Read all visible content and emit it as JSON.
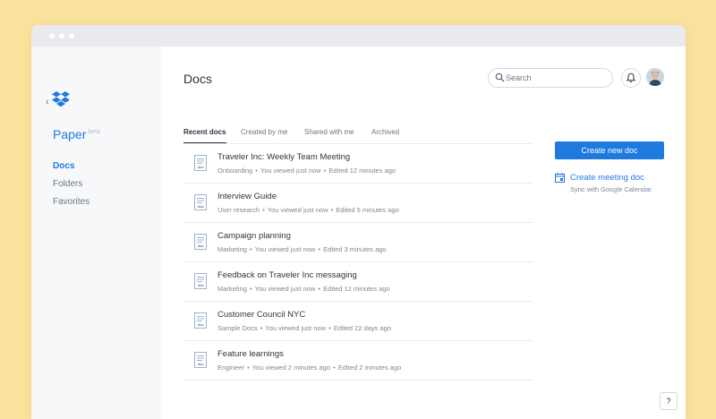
{
  "sidebar": {
    "brand_name": "Paper",
    "brand_sup": "beta",
    "items": [
      {
        "label": "Docs",
        "active": true
      },
      {
        "label": "Folders",
        "active": false
      },
      {
        "label": "Favorites",
        "active": false
      }
    ]
  },
  "header": {
    "title": "Docs",
    "search_placeholder": "Search"
  },
  "tabs": [
    {
      "label": "Recent docs",
      "active": true
    },
    {
      "label": "Created by me",
      "active": false
    },
    {
      "label": "Shared with me",
      "active": false
    },
    {
      "label": "Archived",
      "active": false
    }
  ],
  "docs": [
    {
      "title": "Traveler Inc: Weekly Team Meeting",
      "folder": "Onboarding",
      "viewed": "You viewed just now",
      "edited": "Edited 12 minutes ago"
    },
    {
      "title": "Interview Guide",
      "folder": "User research",
      "viewed": "You viewed just now",
      "edited": "Edited 5 minutes ago"
    },
    {
      "title": "Campaign planning",
      "folder": "Marketing",
      "viewed": "You viewed just now",
      "edited": "Edited 3 minutes ago"
    },
    {
      "title": "Feedback on Traveler Inc messaging",
      "folder": "Marketing",
      "viewed": "You viewed just now",
      "edited": "Edited 12 minutes ago"
    },
    {
      "title": "Customer Council NYC",
      "folder": "Sample Docs",
      "viewed": "You viewed just now",
      "edited": "Edited 22 days ago"
    },
    {
      "title": "Feature learnings",
      "folder": "Engineer",
      "viewed": "You viewed 2 minutes ago",
      "edited": "Edited 2 minutes ago"
    }
  ],
  "actions": {
    "create_label": "Create new doc",
    "meeting_title": "Create meeting doc",
    "meeting_sub": "Sync with Google Calendar"
  },
  "help_label": "?",
  "separator": "•",
  "colors": {
    "accent": "#1f7ae0",
    "background": "#fbe29c"
  }
}
